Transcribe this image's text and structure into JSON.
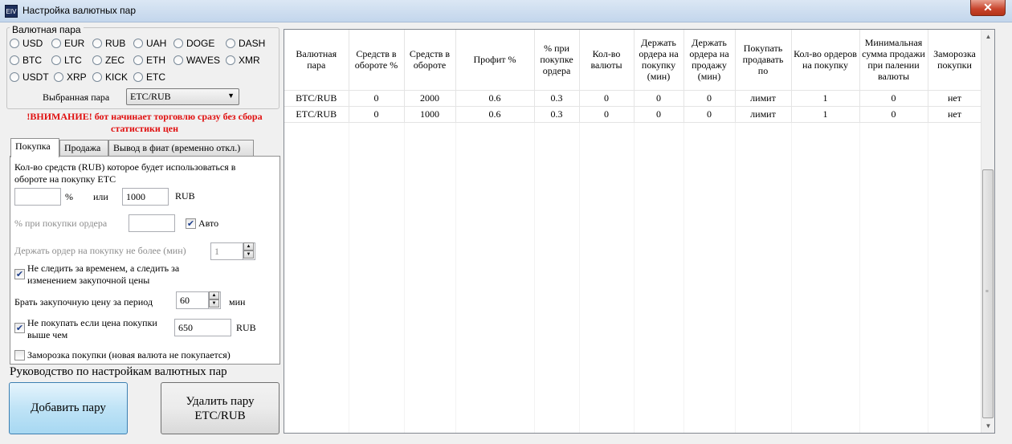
{
  "window": {
    "title": "Настройка валютных пар",
    "icon_text": "EIV",
    "close_label": "✕"
  },
  "currency_group": {
    "title": "Валютная пара",
    "options": [
      "USD",
      "EUR",
      "RUB",
      "UAH",
      "DOGE",
      "DASH",
      "BTC",
      "LTC",
      "ZEC",
      "ETH",
      "WAVES",
      "XMR",
      "USDT",
      "XRP",
      "KICK",
      "ETC"
    ]
  },
  "selected_pair": {
    "label": "Выбранная пара",
    "value": "ETC/RUB"
  },
  "warning": "!ВНИМАНИЕ! бот начинает торговлю сразу без сбора статистики цен",
  "tabs": [
    "Покупка",
    "Продажа",
    "Вывод в фиат (временно откл.)"
  ],
  "buy_tab": {
    "funds_label": "Кол-во средств (RUB) которое будет использоваться в обороте на покупку ETC",
    "percent_value": "",
    "percent_unit": "%",
    "or_label": "или",
    "rub_value": "1000",
    "rub_unit": "RUB",
    "order_percent_label": "% при покупки ордера",
    "order_percent_value": "",
    "auto_label": "Авто",
    "hold_label": "Держать ордер на покупку не более (мин)",
    "hold_value": "1",
    "watch_price_label": "Не следить за временем, а следить за изменением закупочной цены",
    "period_label": "Брать закупочную цену за период",
    "period_value": "60",
    "period_unit": "мин",
    "no_buy_label": "Не покупать если цена покупки выше чем",
    "no_buy_value": "650",
    "no_buy_unit": "RUB",
    "freeze_label": "Заморозка покупки (новая валюта не покупается)"
  },
  "guide_label": "Руководство по настройкам валютных пар",
  "add_button": "Добавить пару",
  "delete_button": "Удалить пару ETC/RUB",
  "table": {
    "columns": [
      "Валютная пара",
      "Средств в обороте %",
      "Средств в обороте",
      "Профит %",
      "% при покупке ордера",
      "Кол-во валюты",
      "Держать ордера на покупку (мин)",
      "Держать ордера на продажу (мин)",
      "Покупать продавать по",
      "Кол-во ордеров на покупку",
      "Минимальная сумма продажи при палении валюты",
      "Заморозка покупки"
    ],
    "rows": [
      [
        "BTC/RUB",
        "0",
        "2000",
        "0.6",
        "0.3",
        "0",
        "0",
        "0",
        "лимит",
        "1",
        "0",
        "нет"
      ],
      [
        "ETC/RUB",
        "0",
        "1000",
        "0.6",
        "0.3",
        "0",
        "0",
        "0",
        "лимит",
        "1",
        "0",
        "нет"
      ]
    ]
  }
}
